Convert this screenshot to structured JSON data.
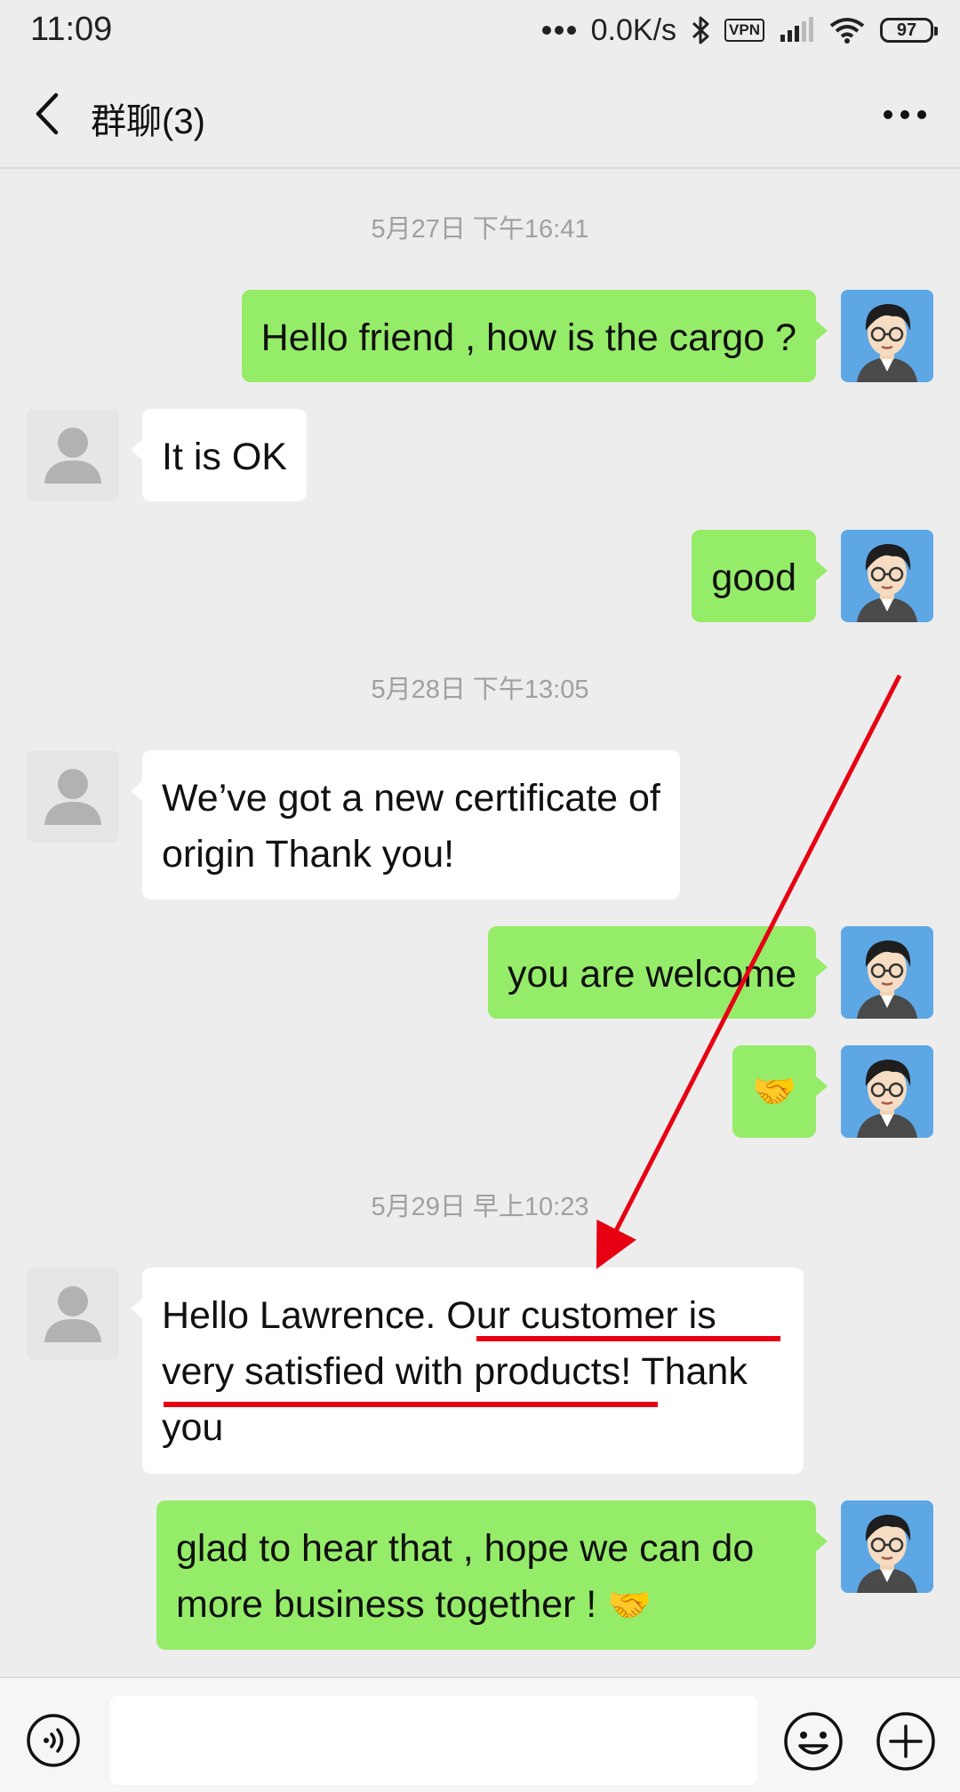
{
  "status_bar": {
    "time": "11:09",
    "network_speed": "0.0K/s",
    "vpn_label": "VPN",
    "battery_level": "97",
    "icons": [
      "more-dots-icon",
      "bluetooth-icon",
      "vpn-icon",
      "signal-icon",
      "wifi-icon",
      "battery-icon"
    ]
  },
  "header": {
    "title": "群聊(3)",
    "back_icon": "chevron-left-icon",
    "more_icon": "more-horizontal-icon"
  },
  "chat": {
    "timestamps": [
      "5月27日 下午16:41",
      "5月28日 下午13:05",
      "5月29日 早上10:23"
    ],
    "messages": [
      {
        "sender": "self",
        "text": "Hello friend , how is the cargo ?"
      },
      {
        "sender": "other",
        "text": "It is OK"
      },
      {
        "sender": "self",
        "text": "good"
      },
      {
        "sender": "other",
        "text": "We’ve got a new certificate of origin Thank you!"
      },
      {
        "sender": "self",
        "text": "you are welcome"
      },
      {
        "sender": "self",
        "text": "🤝"
      },
      {
        "sender": "other",
        "text": "Hello Lawrence. Our customer is very satisfied with products! Thank you"
      },
      {
        "sender": "self",
        "text": "glad to hear that , hope we can do more business together ! 🤝"
      }
    ],
    "message_lines": {
      "m3": [
        "We’ve got a new certificate of",
        "origin Thank you!"
      ],
      "m6": [
        "Hello Lawrence. Our customer is",
        "very satisfied with products! Thank",
        "you"
      ],
      "m7_line1": "glad to hear that , hope we can do",
      "m7_line2": "more business together !",
      "m7_emoji": "🤝"
    }
  },
  "input_bar": {
    "value": "",
    "icons": [
      "voice-icon",
      "emoji-icon",
      "plus-icon"
    ]
  },
  "colors": {
    "background": "#ededed",
    "self_bubble": "#95ec69",
    "other_bubble": "#ffffff",
    "annotation": "#e60012",
    "timestamp": "#a0a0a0"
  }
}
